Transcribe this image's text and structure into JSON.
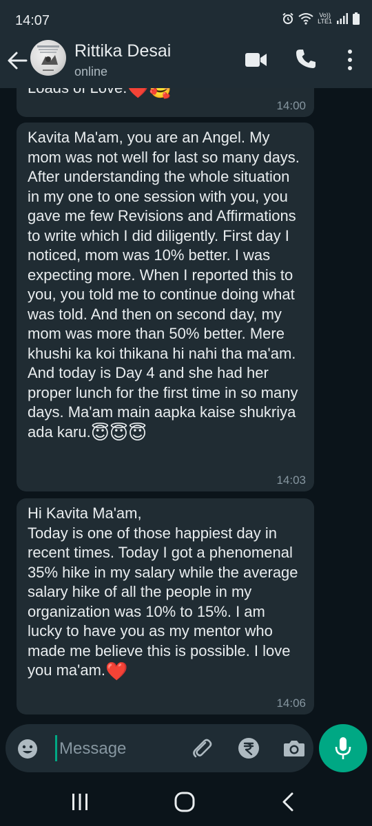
{
  "status_bar": {
    "time": "14:07",
    "network_label_top": "Vo))",
    "network_label_bottom": "LTE1"
  },
  "header": {
    "contact_name": "Rittika Desai",
    "contact_status": "online"
  },
  "messages": [
    {
      "text": "Loads of Love.",
      "emojis": "❤️🥰",
      "time": "14:00"
    },
    {
      "text": "Kavita Ma'am, you are an Angel. My mom was not well for last so many days. After understanding the whole situation in my one to one session with you, you gave me few Revisions and Affirmations to write which I did diligently. First day I noticed, mom was 10% better. I was expecting more. When I reported this to you, you told me to continue doing what was told. And then on second day, my mom was more than 50% better. Mere khushi ka koi thikana hi nahi tha ma'am. And today is Day 4 and she had her proper lunch for the first time in so many days. Ma'am main aapka kaise shukriya ada karu.",
      "emojis": "😇😇😇",
      "time": "14:03"
    },
    {
      "text": "Hi Kavita Ma'am,\nToday is one of those happiest day in recent times. Today I got a phenomenal 35% hike in my salary while the average salary hike of all the people in my organization was 10% to 15%. I am lucky to have you as my mentor who made me believe this is possible. I love you ma'am.",
      "emojis": "❤️",
      "time": "14:06"
    }
  ],
  "input": {
    "placeholder": "Message"
  },
  "icons": {
    "back": "arrow-left-icon",
    "video": "video-camera-icon",
    "call": "phone-icon",
    "menu": "more-vertical-icon",
    "emoji": "smiley-icon",
    "attach": "paperclip-icon",
    "payment": "rupee-icon",
    "camera": "camera-icon",
    "mic": "microphone-icon"
  },
  "colors": {
    "background": "#0b141a",
    "header": "#1f2c34",
    "bubble_incoming": "#202c33",
    "accent": "#00a884",
    "text_primary": "#e9edef",
    "text_secondary": "#8696a0"
  }
}
